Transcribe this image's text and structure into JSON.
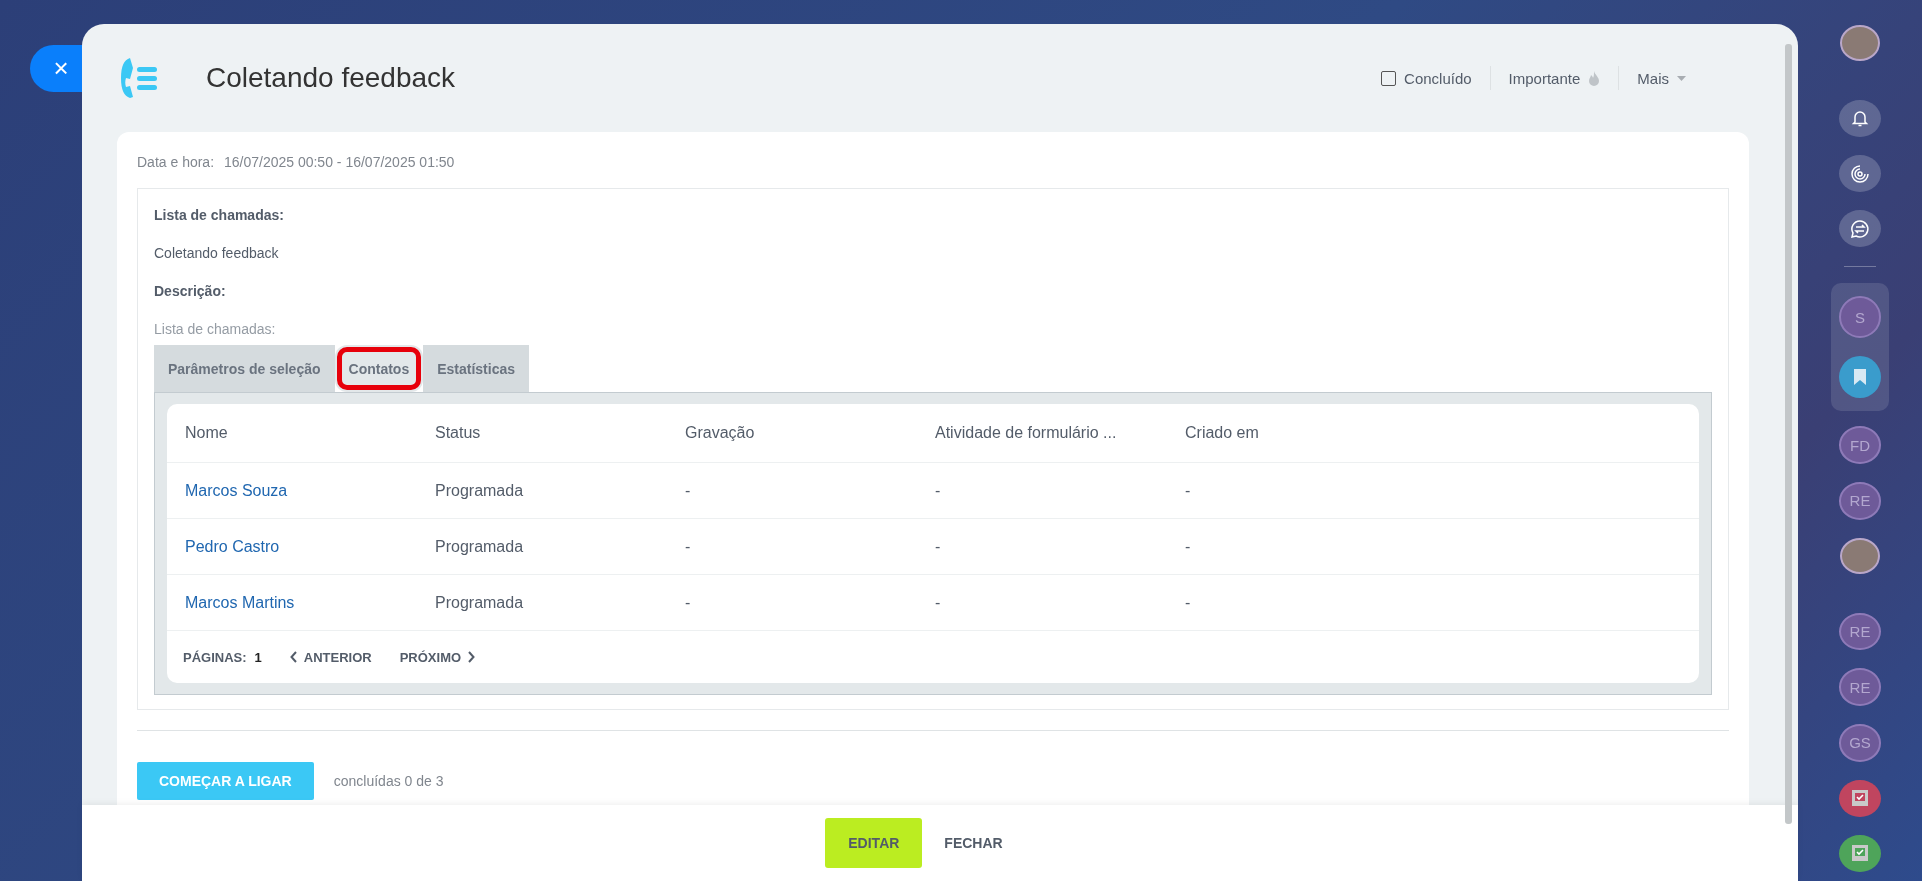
{
  "close_button": {
    "label": "×"
  },
  "header": {
    "title": "Coletando feedback",
    "done": {
      "label": "Concluído",
      "checked": false
    },
    "important": {
      "label": "Importante"
    },
    "more": {
      "label": "Mais"
    }
  },
  "details": {
    "date_label": "Data e hora:",
    "date_value": "16/07/2025 00:50 - 16/07/2025 01:50",
    "list_title_label": "Lista de chamadas:",
    "list_title_value": "Coletando feedback",
    "description_label": "Descrição:",
    "call_list_label": "Lista de chamadas:"
  },
  "tabs": [
    {
      "label": "Parâmetros de seleção",
      "selected": false,
      "highlighted": false
    },
    {
      "label": "Contatos",
      "selected": true,
      "highlighted": true
    },
    {
      "label": "Estatísticas",
      "selected": false,
      "highlighted": false
    }
  ],
  "table": {
    "columns": [
      "Nome",
      "Status",
      "Gravação",
      "Atividade de formulário ...",
      "Criado em"
    ],
    "rows": [
      [
        "Marcos Souza",
        "Programada",
        "-",
        "-",
        "-"
      ],
      [
        "Pedro Castro",
        "Programada",
        "-",
        "-",
        "-"
      ],
      [
        "Marcos Martins",
        "Programada",
        "-",
        "-",
        "-"
      ]
    ]
  },
  "pagination": {
    "pages_label": "PÁGINAS:",
    "page": "1",
    "prev": "ANTERIOR",
    "next": "PRÓXIMO"
  },
  "actions": {
    "start_button": "COMEÇAR A LIGAR",
    "progress": "concluídas 0 de 3"
  },
  "footer": {
    "buttons": [
      "EDITAR",
      "FECHAR"
    ]
  },
  "sidebar": {
    "items": [
      {
        "kind": "photo"
      },
      {
        "kind": "bell"
      },
      {
        "kind": "spiral"
      },
      {
        "kind": "chat"
      },
      {
        "kind": "divider"
      }
    ],
    "pinned": [
      {
        "kind": "initials",
        "text": "S"
      },
      {
        "kind": "bookmark"
      }
    ],
    "chats": [
      {
        "kind": "initials",
        "text": "FD"
      },
      {
        "kind": "initials",
        "text": "RE"
      },
      {
        "kind": "photo"
      },
      {
        "kind": "initials",
        "text": "RE"
      },
      {
        "kind": "initials",
        "text": "RE"
      },
      {
        "kind": "initials",
        "text": "GS"
      },
      {
        "kind": "task",
        "color": "#c0455f"
      },
      {
        "kind": "task",
        "color": "#4ea45a"
      }
    ]
  }
}
